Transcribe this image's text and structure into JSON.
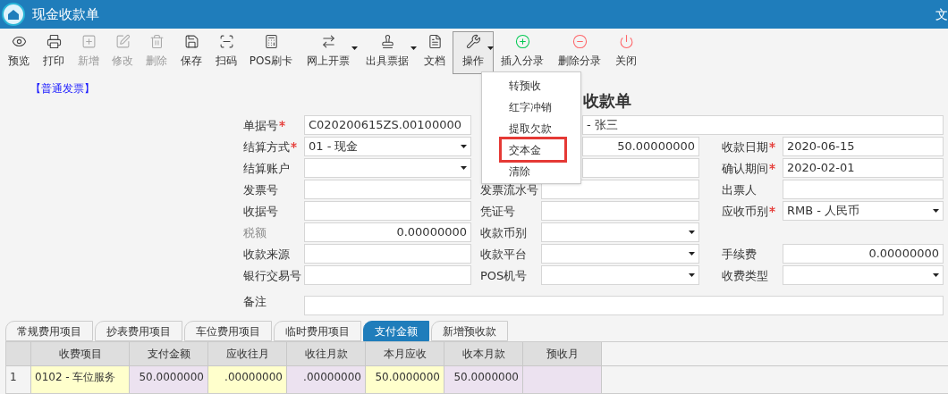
{
  "window": {
    "title": "现金收款单",
    "title_right": "文"
  },
  "toolbar": [
    {
      "label": "预览",
      "disabled": false
    },
    {
      "label": "打印",
      "disabled": false
    },
    {
      "label": "新增",
      "disabled": true
    },
    {
      "label": "修改",
      "disabled": true
    },
    {
      "label": "删除",
      "disabled": true
    },
    {
      "label": "保存",
      "disabled": false
    },
    {
      "label": "扫码",
      "disabled": false
    },
    {
      "label": "POS刷卡",
      "disabled": false
    },
    {
      "label": "网上开票",
      "disabled": false,
      "dropdown": true
    },
    {
      "label": "出具票据",
      "disabled": false,
      "dropdown": true
    },
    {
      "label": "文档",
      "disabled": false
    },
    {
      "label": "操作",
      "disabled": false,
      "dropdown": true,
      "expanded": true
    },
    {
      "label": "插入分录",
      "disabled": false
    },
    {
      "label": "删除分录",
      "disabled": false
    },
    {
      "label": "关闭",
      "disabled": false
    }
  ],
  "menu": [
    {
      "label": "转预收",
      "highlighted": false
    },
    {
      "label": "红字冲销",
      "highlighted": false
    },
    {
      "label": "提取欠款",
      "highlighted": false
    },
    {
      "label": "交本金",
      "highlighted": true
    },
    {
      "label": "清除",
      "highlighted": false
    }
  ],
  "invoice_type": "【普通发票】",
  "heading": "收款单",
  "form": [
    {
      "left": {
        "label": "单据号",
        "required": true,
        "kind": "text",
        "value": "C020200615ZS.00100000"
      },
      "middle": {
        "kind": "text",
        "value": "- 张三",
        "wide": true
      }
    },
    {
      "left": {
        "label": "结算方式",
        "required": true,
        "kind": "select",
        "value": "01 - 现金"
      },
      "middle": {
        "kind": "number",
        "value": "50.00000000"
      },
      "right": {
        "label": "收款日期",
        "required": true,
        "kind": "text",
        "value": "2020-06-15"
      }
    },
    {
      "left": {
        "label": "结算账户",
        "required": false,
        "kind": "select"
      },
      "middle": {
        "kind": "text"
      },
      "right": {
        "label": "确认期间",
        "required": true,
        "kind": "text",
        "value": "2020-02-01"
      }
    },
    {
      "left": {
        "label": "发票号",
        "required": false,
        "kind": "text"
      },
      "middle": {
        "label": "发票流水号",
        "required": false,
        "kind": "text"
      },
      "right": {
        "label": "出票人",
        "required": false,
        "kind": "text"
      }
    },
    {
      "left": {
        "label": "收据号",
        "required": false,
        "kind": "text"
      },
      "middle": {
        "label": "凭证号",
        "required": false,
        "kind": "text"
      },
      "right": {
        "label": "应收币别",
        "required": true,
        "kind": "select",
        "value": "RMB - 人民币"
      }
    },
    {
      "left": {
        "label": "税额",
        "required": false,
        "kind": "number",
        "value": "0.00000000",
        "readonly": true
      },
      "middle": {
        "label": "收款币别",
        "required": false,
        "kind": "select"
      }
    },
    {
      "left": {
        "label": "收款来源",
        "required": false,
        "kind": "text"
      },
      "middle": {
        "label": "收款平台",
        "required": false,
        "kind": "select"
      },
      "right": {
        "label": "手续费",
        "required": false,
        "kind": "number",
        "value": "0.00000000"
      }
    },
    {
      "left": {
        "label": "银行交易号",
        "required": false,
        "kind": "text"
      },
      "middle": {
        "label": "POS机号",
        "required": false,
        "kind": "select"
      },
      "right": {
        "label": "收费类型",
        "required": false,
        "kind": "select"
      }
    },
    {
      "left": {
        "label": "备注",
        "required": false,
        "kind": "text",
        "wide": true
      }
    }
  ],
  "tabs": [
    {
      "label": "常规费用项目",
      "selected": false
    },
    {
      "label": "抄表费用项目",
      "selected": false
    },
    {
      "label": "车位费用项目",
      "selected": false
    },
    {
      "label": "临时费用项目",
      "selected": false
    },
    {
      "label": "支付金额",
      "selected": true
    },
    {
      "label": "新增预收款",
      "selected": false
    }
  ],
  "table": {
    "columns": [
      "收费项目",
      "支付金额",
      "应收往月",
      "收往月款",
      "本月应收",
      "收本月款",
      "预收月"
    ],
    "rows": [
      {
        "number": "1",
        "cells": [
          {
            "text": "0102 - 车位服务",
            "highlight": true
          },
          {
            "text": "50.0000000",
            "highlight": false
          },
          {
            "text": ".00000000",
            "highlight": true
          },
          {
            "text": ".00000000",
            "highlight": false
          },
          {
            "text": "50.0000000",
            "highlight": true
          },
          {
            "text": "50.0000000",
            "highlight": false
          },
          {
            "highlight": false
          }
        ]
      }
    ]
  }
}
